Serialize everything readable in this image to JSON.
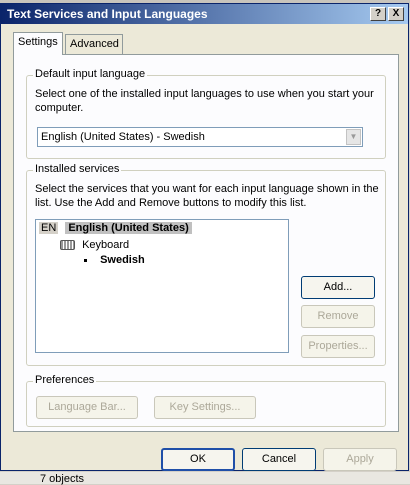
{
  "window": {
    "title": "Text Services and Input Languages"
  },
  "titlebar": {
    "help_label": "?",
    "close_label": "X"
  },
  "tabs": [
    {
      "label": "Settings",
      "active": true
    },
    {
      "label": "Advanced",
      "active": false
    }
  ],
  "default_input": {
    "group_label": "Default input language",
    "description": "Select one of the installed input languages to use when you start your computer.",
    "selected": "English (United States) - Swedish"
  },
  "installed_services": {
    "group_label": "Installed services",
    "description": "Select the services that you want for each input language shown in the list. Use the Add and Remove buttons to modify this list.",
    "language_code": "EN",
    "language_name": "English (United States)",
    "category": "Keyboard",
    "layout": "Swedish",
    "buttons": {
      "add": "Add...",
      "remove": "Remove",
      "properties": "Properties..."
    }
  },
  "preferences": {
    "group_label": "Preferences",
    "language_bar": "Language Bar...",
    "key_settings": "Key Settings..."
  },
  "footer": {
    "ok": "OK",
    "cancel": "Cancel",
    "apply": "Apply"
  },
  "background": {
    "partial_text": "7 objects"
  },
  "colors": {
    "title_start": "#0a246a",
    "title_end": "#a6caf0",
    "dialog_bg": "#ece9d8"
  }
}
